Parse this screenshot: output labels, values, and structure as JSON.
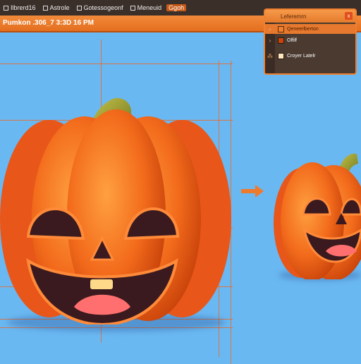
{
  "menubar": {
    "items": [
      {
        "label": "Ilbrerd16",
        "highlight": false
      },
      {
        "label": "Astrole",
        "highlight": false
      },
      {
        "label": "Gotessogeonf",
        "highlight": false
      },
      {
        "label": "Meneuid",
        "highlight": false
      },
      {
        "label": "Ggoh",
        "highlight": true
      }
    ]
  },
  "titlebar": {
    "title": "Pumkon .306_7 3:3D 16 PM"
  },
  "layers_panel": {
    "title": "Leferemrn",
    "rows": [
      {
        "label": "Qeneerlberton",
        "selected": true,
        "icon": "plus-icon"
      },
      {
        "label": "Olfilf",
        "selected": false,
        "icon": "arrow-right-icon"
      },
      {
        "label": "Croyer Latelr",
        "selected": false,
        "icon": "layer-icon"
      }
    ]
  },
  "canvas": {
    "arrow_icon": "arrow-right-icon"
  },
  "colors": {
    "accent": "#e8772a",
    "background": "#6ab8f2",
    "pumpkin": "#f26a1b",
    "stem": "#8a9a2a"
  }
}
